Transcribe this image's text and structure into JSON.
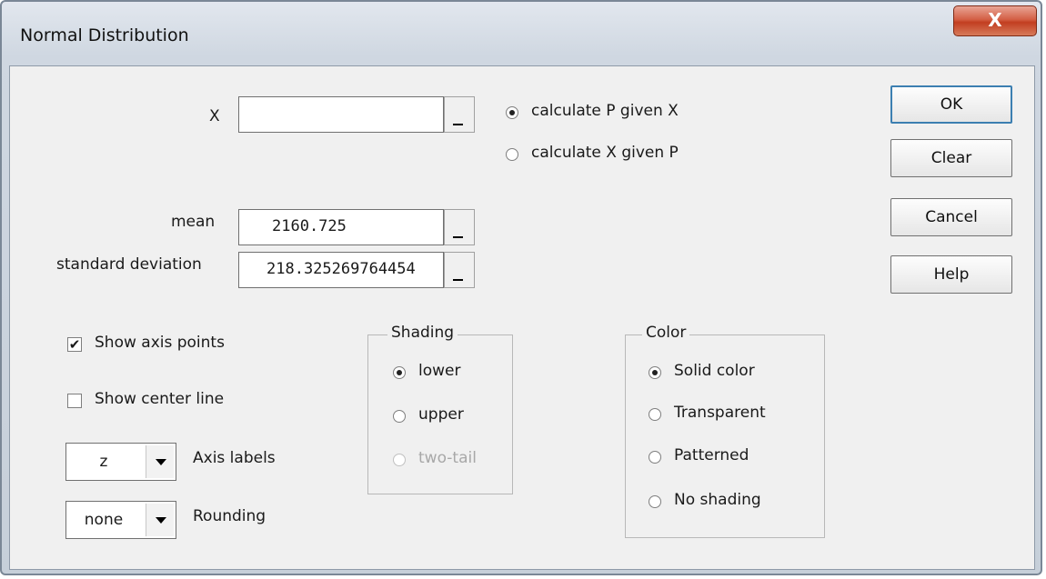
{
  "window": {
    "title": "Normal Distribution",
    "close_glyph": "X"
  },
  "fields": {
    "x_label": "X",
    "x_value": "",
    "mean_label": "mean",
    "mean_value": "2160.725",
    "sd_label": "standard deviation",
    "sd_value": "218.325269764454"
  },
  "calc_mode": {
    "options": [
      {
        "label": "calculate P given X",
        "selected": true
      },
      {
        "label": "calculate X given P",
        "selected": false
      }
    ]
  },
  "buttons": {
    "ok": "OK",
    "clear": "Clear",
    "cancel": "Cancel",
    "help": "Help"
  },
  "options": {
    "show_axis_points": "Show axis points",
    "show_axis_points_checked": true,
    "show_center_line": "Show center line",
    "show_center_line_checked": false
  },
  "axis_labels": {
    "value": "z",
    "label": "Axis labels"
  },
  "rounding": {
    "value": "none",
    "label": "Rounding"
  },
  "shading": {
    "title": "Shading",
    "options": [
      {
        "label": "lower",
        "selected": true,
        "enabled": true
      },
      {
        "label": "upper",
        "selected": false,
        "enabled": true
      },
      {
        "label": "two-tail",
        "selected": false,
        "enabled": false
      }
    ]
  },
  "color": {
    "title": "Color",
    "options": [
      {
        "label": "Solid color",
        "selected": true
      },
      {
        "label": "Transparent",
        "selected": false
      },
      {
        "label": "Patterned",
        "selected": false
      },
      {
        "label": "No shading",
        "selected": false
      }
    ]
  }
}
